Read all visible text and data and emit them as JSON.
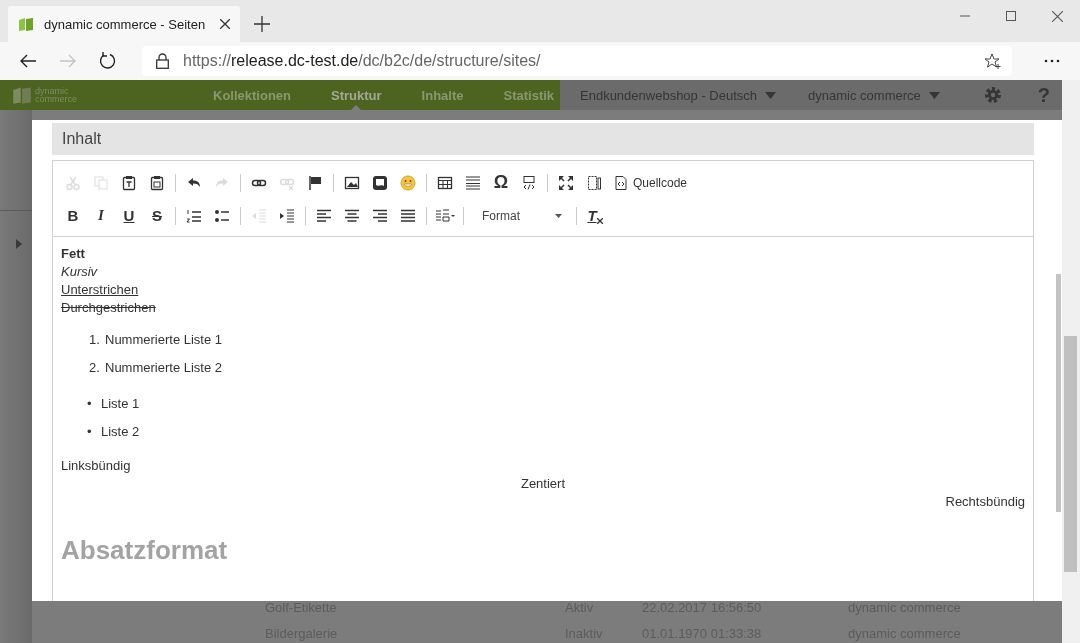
{
  "browser": {
    "tab": {
      "title": "dynamic commerce - Seiten"
    },
    "url": {
      "scheme": "https://",
      "host": "release.dc-test.de",
      "path": "/dc/b2c/de/structure/sites/"
    }
  },
  "app_nav": {
    "logo": [
      "dynamic",
      "commerce"
    ],
    "items": [
      {
        "label": "Kollektionen",
        "selected": false
      },
      {
        "label": "Struktur",
        "selected": true
      },
      {
        "label": "Inhalte",
        "selected": false
      },
      {
        "label": "Statistik",
        "selected": false
      }
    ],
    "shop_select": "Endkundenwebshop - Deutsch",
    "company_select": "dynamic commerce",
    "help": "?"
  },
  "background_rows": [
    {
      "name": "Golf-Etikette",
      "status": "Aktiv",
      "date": "22.02.2017 16:56:50",
      "author": "dynamic commerce"
    },
    {
      "name": "Bildergalerie",
      "status": "Inaktiv",
      "date": "01.01.1970 01:33:38",
      "author": "dynamic commerce"
    }
  ],
  "dialog": {
    "section_title": "Inhalt",
    "toolbar": [
      [
        [
          {
            "kind": "cut",
            "disabled": true
          },
          {
            "kind": "copy",
            "disabled": true
          },
          {
            "kind": "paste-text",
            "disabled": false
          },
          {
            "kind": "paste-word",
            "disabled": false
          }
        ],
        [
          {
            "kind": "undo",
            "disabled": false
          },
          {
            "kind": "redo",
            "disabled": true
          }
        ],
        [
          {
            "kind": "link",
            "disabled": false
          },
          {
            "kind": "unlink",
            "disabled": true
          },
          {
            "kind": "anchor",
            "disabled": false
          }
        ],
        [
          {
            "kind": "image",
            "disabled": false
          },
          {
            "kind": "iframe",
            "disabled": false
          },
          {
            "kind": "smiley",
            "disabled": false
          }
        ],
        [
          {
            "kind": "table",
            "disabled": false
          },
          {
            "kind": "hr",
            "disabled": false
          },
          {
            "kind": "specialchar",
            "label": "Ω",
            "disabled": false
          },
          {
            "kind": "div",
            "disabled": false
          }
        ],
        [
          {
            "kind": "maximize",
            "disabled": false
          },
          {
            "kind": "showblocks",
            "disabled": false
          },
          {
            "kind": "source",
            "label": "Quellcode",
            "disabled": false
          }
        ]
      ],
      [
        [
          {
            "kind": "bold",
            "label": "B",
            "disabled": false
          },
          {
            "kind": "italic",
            "label": "I",
            "disabled": false
          },
          {
            "kind": "underline",
            "label": "U",
            "disabled": false
          },
          {
            "kind": "strike",
            "label": "S",
            "disabled": false
          }
        ],
        [
          {
            "kind": "ol",
            "disabled": false
          },
          {
            "kind": "ul",
            "disabled": false
          }
        ],
        [
          {
            "kind": "outdent",
            "disabled": true
          },
          {
            "kind": "indent",
            "disabled": false
          }
        ],
        [
          {
            "kind": "align-left",
            "disabled": false
          },
          {
            "kind": "align-center",
            "disabled": false
          },
          {
            "kind": "align-right",
            "disabled": false
          },
          {
            "kind": "justify",
            "disabled": false
          }
        ],
        [
          {
            "kind": "language",
            "disabled": false
          }
        ],
        [
          {
            "kind": "format",
            "label": "Format",
            "disabled": false
          }
        ],
        [
          {
            "kind": "removeformat",
            "label": "T",
            "disabled": false
          }
        ]
      ]
    ],
    "content": [
      {
        "kind": "bold",
        "text": "Fett"
      },
      {
        "kind": "italic",
        "text": "Kursiv"
      },
      {
        "kind": "underline",
        "text": "Unterstrichen"
      },
      {
        "kind": "strike",
        "text": "Durchgestrichen"
      },
      {
        "kind": "ordered_list",
        "items": [
          {
            "marker": "1.",
            "text": "Nummerierte Liste 1"
          },
          {
            "marker": "2.",
            "text": "Nummerierte Liste 2"
          }
        ]
      },
      {
        "kind": "bullet_list",
        "items": [
          {
            "marker": "•",
            "text": "Liste 1"
          },
          {
            "marker": "•",
            "text": "Liste 2"
          }
        ]
      },
      {
        "kind": "left",
        "text": "Linksbündig"
      },
      {
        "kind": "center",
        "text": "Zentiert"
      },
      {
        "kind": "right",
        "text": "Rechtsbündig"
      },
      {
        "kind": "heading",
        "text": "Absatzformat"
      }
    ]
  }
}
